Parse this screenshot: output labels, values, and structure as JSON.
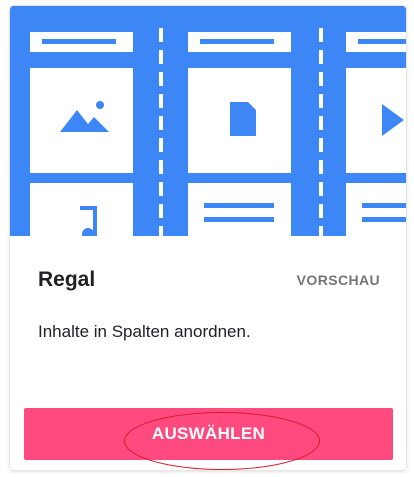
{
  "card": {
    "title": "Regal",
    "preview_label": "VORSCHAU",
    "description": "Inhalte in Spalten anordnen.",
    "select_label": "AUSWÄHLEN"
  },
  "colors": {
    "preview_background": "#3d86f5",
    "button_background": "#ff4a7f",
    "annotation": "#d7182a"
  },
  "icons": [
    "landscape-image-icon",
    "document-icon",
    "play-icon",
    "music-note-icon"
  ]
}
